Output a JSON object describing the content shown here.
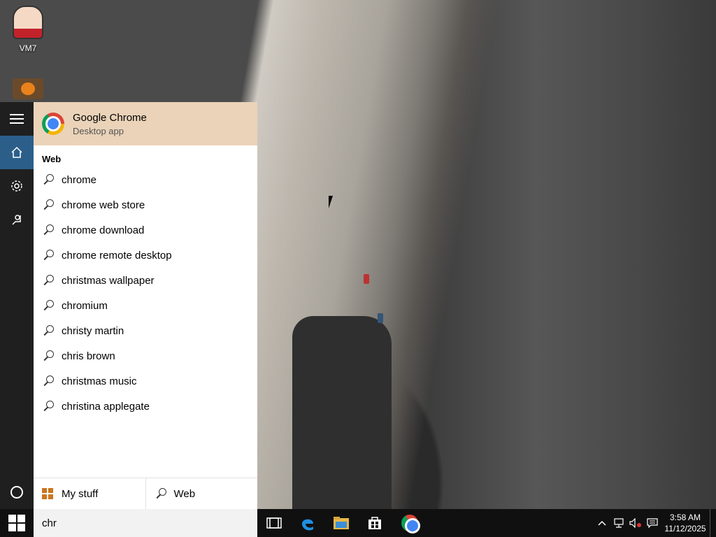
{
  "desktop": {
    "icons": [
      {
        "label": "VM7",
        "icon": "user-avatar-icon"
      },
      {
        "label": "",
        "icon": "pumpkin-folder-icon"
      }
    ]
  },
  "start_menu": {
    "rail": {
      "items": [
        "hamburger-menu-icon",
        "home-icon",
        "settings-icon",
        "feedback-icon",
        "cortana-icon"
      ]
    },
    "best_match": {
      "title": "Google Chrome",
      "subtitle": "Desktop app",
      "icon": "chrome-icon"
    },
    "web_section_label": "Web",
    "suggestions": [
      "chrome",
      "chrome web store",
      "chrome download",
      "chrome remote desktop",
      "christmas wallpaper",
      "chromium",
      "christy martin",
      "chris brown",
      "christmas music",
      "christina applegate"
    ],
    "scopes": {
      "my_stuff": "My stuff",
      "web": "Web"
    }
  },
  "taskbar": {
    "search_value": "chr",
    "pinned": [
      "task-view-icon",
      "edge-icon",
      "file-explorer-icon",
      "store-icon",
      "chrome-icon"
    ],
    "clock": {
      "time": "3:58 AM",
      "date": "11/12/2025"
    }
  },
  "colors": {
    "best_match_bg": "#ead3b8",
    "rail_active": "#2b5f8a",
    "taskbar_bg": "#101010"
  }
}
